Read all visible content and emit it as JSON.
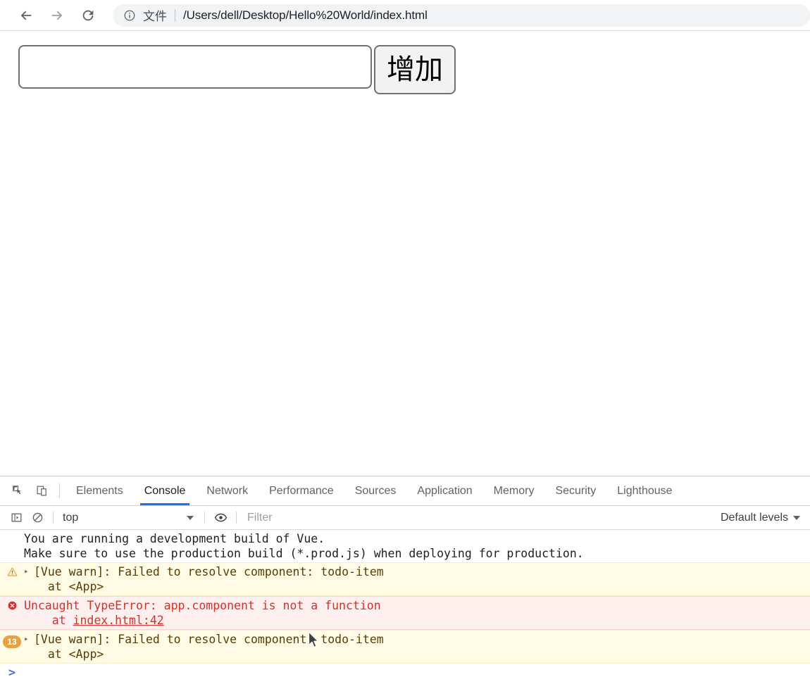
{
  "browser": {
    "back_label": "Back",
    "forward_label": "Forward",
    "reload_label": "Reload",
    "omnibox": {
      "info_icon": "info-circle-icon",
      "scheme_label": "文件",
      "url": "/Users/dell/Desktop/Hello%20World/index.html"
    }
  },
  "page": {
    "todo_input_value": "",
    "todo_input_placeholder": "",
    "add_button_label": "增加"
  },
  "devtools": {
    "inspect_icon": "inspect-element-icon",
    "device_icon": "device-toolbar-icon",
    "tabs": [
      {
        "label": "Elements",
        "active": false
      },
      {
        "label": "Console",
        "active": true
      },
      {
        "label": "Network",
        "active": false
      },
      {
        "label": "Performance",
        "active": false
      },
      {
        "label": "Sources",
        "active": false
      },
      {
        "label": "Application",
        "active": false
      },
      {
        "label": "Memory",
        "active": false
      },
      {
        "label": "Security",
        "active": false
      },
      {
        "label": "Lighthouse",
        "active": false
      }
    ],
    "toolbar": {
      "sidebar_icon": "console-sidebar-icon",
      "clear_icon": "clear-console-icon",
      "context_value": "top",
      "eye_icon": "live-expression-icon",
      "filter_placeholder": "Filter",
      "filter_value": "",
      "levels_label": "Default levels"
    },
    "messages": [
      {
        "type": "plain",
        "line1": "You are running a development build of Vue.",
        "line2": "Make sure to use the production build (*.prod.js) when deploying for production."
      },
      {
        "type": "warn",
        "icon": "warning-triangle-icon",
        "expand": "▸",
        "line1": "[Vue warn]: Failed to resolve component: todo-item",
        "line2": "  at <App>"
      },
      {
        "type": "error",
        "icon": "error-circle-icon",
        "line1": "Uncaught TypeError: app.component is not a function",
        "line2_prefix": "    at ",
        "line2_link": "index.html:42"
      },
      {
        "type": "warn",
        "badge": "13",
        "expand": "▸",
        "line1": "[Vue warn]: Failed to resolve component: todo-item",
        "line2": "  at <App>"
      }
    ],
    "prompt_symbol": ">"
  },
  "colors": {
    "accent_blue": "#1a73e8",
    "error_red": "#d93025",
    "warn_bg": "#fffbe5",
    "error_bg": "#fff0f0",
    "badge_orange": "#e8a33d"
  }
}
